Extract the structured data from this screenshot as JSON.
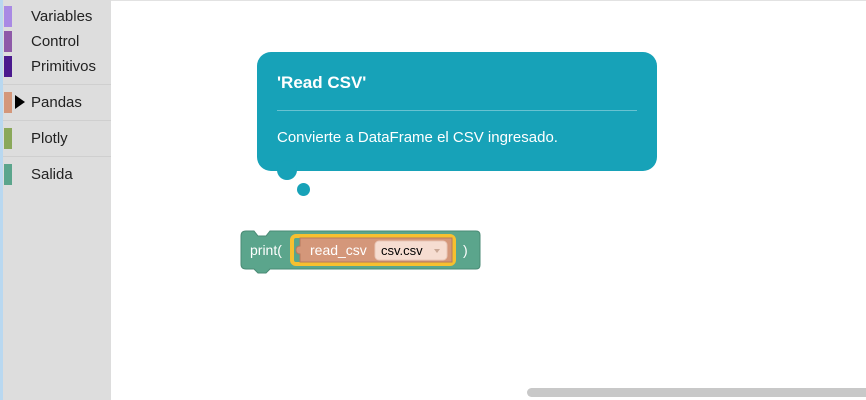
{
  "toolbox": {
    "categories": [
      {
        "label": "Variables",
        "color": "#a98ae4"
      },
      {
        "label": "Control",
        "color": "#8e5aa8"
      },
      {
        "label": "Primitivos",
        "color": "#4a1a8e"
      },
      {
        "label": "Pandas",
        "color": "#d4977a",
        "expanded_arrow": true
      },
      {
        "label": "Plotly",
        "color": "#8aa85a"
      },
      {
        "label": "Salida",
        "color": "#5ba58c"
      }
    ]
  },
  "tooltip": {
    "title": "'Read CSV'",
    "description": "Convierte a DataFrame el CSV ingresado.",
    "color": "#17a2b8"
  },
  "blocks": {
    "print": {
      "label_open": "print(",
      "label_close": ")",
      "color": "#5ba58c"
    },
    "read_csv": {
      "label": "read_csv",
      "dropdown_value": "csv.csv",
      "color": "#d4977a",
      "highlight_color": "#f7c02f"
    }
  }
}
